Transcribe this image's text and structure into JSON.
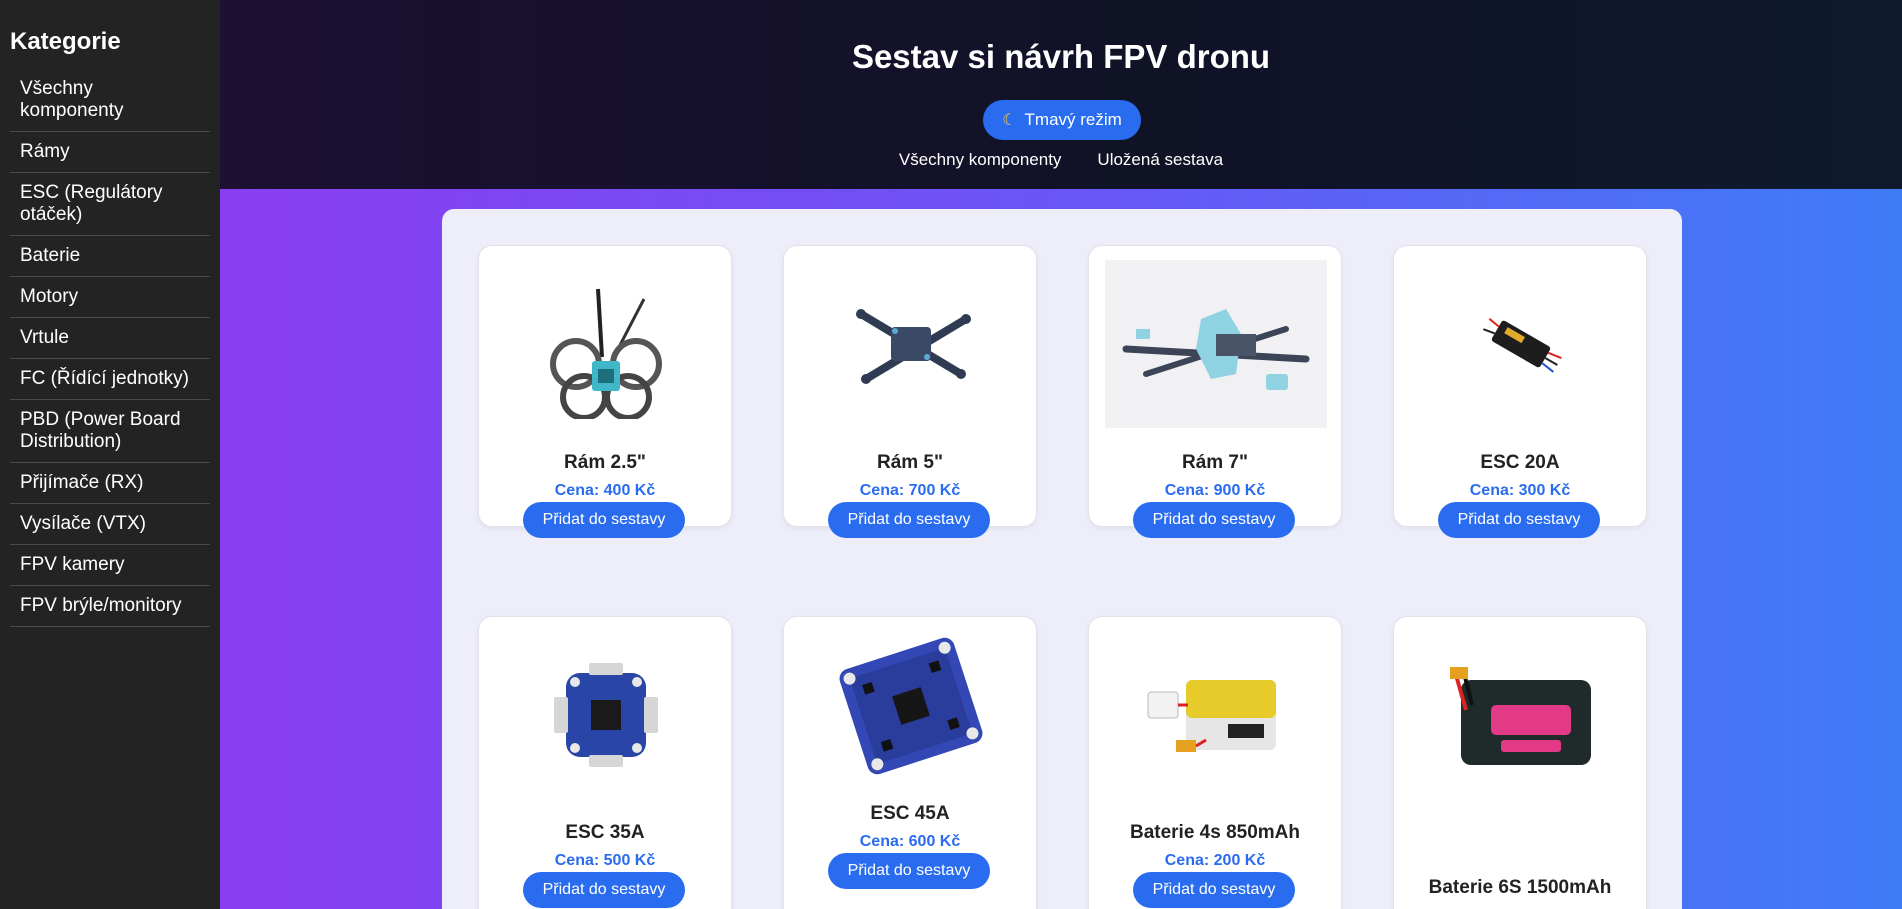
{
  "sidebar": {
    "title": "Kategorie",
    "items": [
      "Všechny komponenty",
      "Rámy",
      "ESC (Regulátory otáček)",
      "Baterie",
      "Motory",
      "Vrtule",
      "FC (Řídící jednotky)",
      "PBD (Power Board Distribution)",
      "Přijímače (RX)",
      "Vysílače (VTX)",
      "FPV kamery",
      "FPV brýle/monitory"
    ]
  },
  "header": {
    "title": "Sestav si návrh FPV dronu",
    "mode_button": "Tmavý režim",
    "nav": [
      "Všechny komponenty",
      "Uložená sestava"
    ]
  },
  "products": [
    {
      "name": "Rám 2.5\"",
      "price": "Cena: 400 Kč",
      "button": "Přidat do sestavy",
      "icon": "frame-2-5-image"
    },
    {
      "name": "Rám 5\"",
      "price": "Cena: 700 Kč",
      "button": "Přidat do sestavy",
      "icon": "frame-5-image"
    },
    {
      "name": "Rám 7\"",
      "price": "Cena: 900 Kč",
      "button": "Přidat do sestavy",
      "icon": "frame-7-image"
    },
    {
      "name": "ESC 20A",
      "price": "Cena: 300 Kč",
      "button": "Přidat do sestavy",
      "icon": "esc-20a-image"
    },
    {
      "name": "ESC 35A",
      "price": "Cena: 500 Kč",
      "button": "Přidat do sestavy",
      "icon": "esc-35a-image"
    },
    {
      "name": "ESC 45A",
      "price": "Cena: 600 Kč",
      "button": "Přidat do sestavy",
      "icon": "esc-45a-image"
    },
    {
      "name": "Baterie 4s 850mAh",
      "price": "Cena: 200 Kč",
      "button": "Přidat do sestavy",
      "icon": "battery-4s-image"
    },
    {
      "name": "Baterie 6S 1500mAh",
      "icon": "battery-6s-image"
    }
  ],
  "colors": {
    "accent": "#2a6cf0",
    "sidebar_bg": "#232323"
  }
}
